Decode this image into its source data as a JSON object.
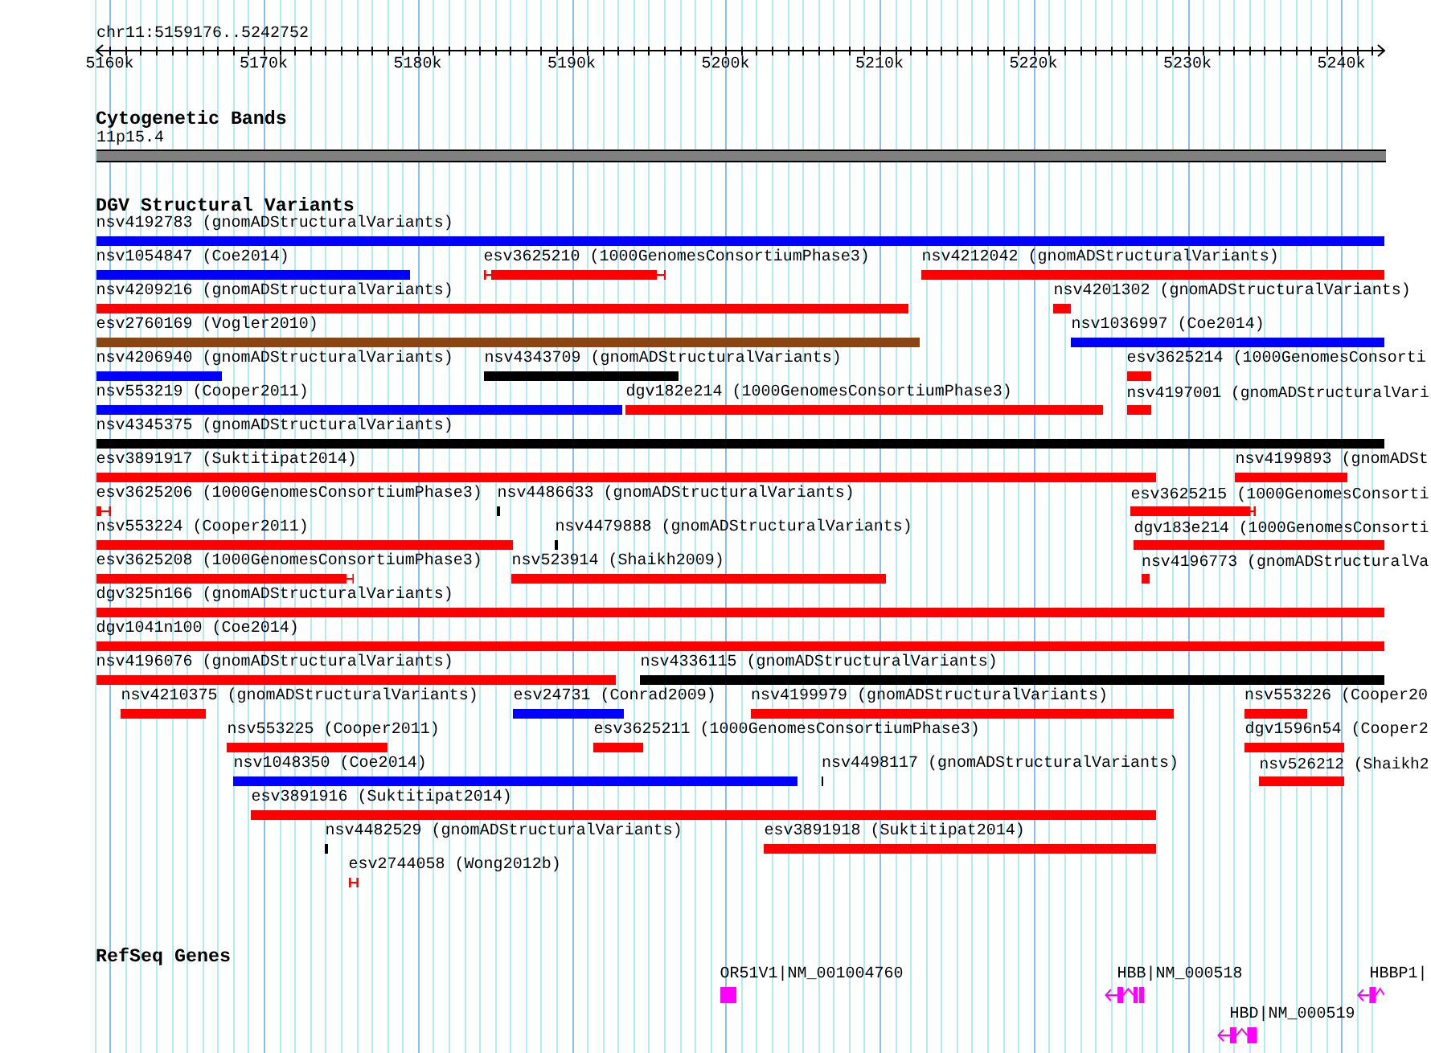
{
  "ruler": {
    "location": "chr11:5159176..5242752",
    "ticks": [
      "5160k",
      "5170k",
      "5180k",
      "5190k",
      "5200k",
      "5210k",
      "5220k",
      "5230k",
      "5240k"
    ]
  },
  "tracks": [
    {
      "kind": "bands",
      "title": "Cytogenetic Bands",
      "features": [
        {
          "label": "11p15.4"
        }
      ]
    },
    {
      "kind": "variants",
      "title": "DGV Structural Variants",
      "features": [
        {
          "label": "nsv4192783 (gnomADStructuralVariants)",
          "color": "#0000ff"
        },
        {
          "label": "nsv1054847 (Coe2014)",
          "color": "#0000ff"
        },
        {
          "label": "esv3625210 (1000GenomesConsortiumPhase3)",
          "color": "#ff0000"
        },
        {
          "label": "nsv4212042 (gnomADStructuralVariants)",
          "color": "#ff0000"
        },
        {
          "label": "nsv4209216 (gnomADStructuralVariants)",
          "color": "#ff0000"
        },
        {
          "label": "nsv4201302 (gnomADStructuralVariants)",
          "color": "#ff0000"
        },
        {
          "label": "esv2760169 (Vogler2010)",
          "color": "#8b4513"
        },
        {
          "label": "nsv1036997 (Coe2014)",
          "color": "#0000ff"
        },
        {
          "label": "nsv4206940 (gnomADStructuralVariants)",
          "color": "#0000ff"
        },
        {
          "label": "nsv4343709 (gnomADStructuralVariants)",
          "color": "#000000"
        },
        {
          "label": "esv3625214 (1000GenomesConsorti",
          "color": "#ff0000"
        },
        {
          "label": "nsv553219 (Cooper2011)",
          "color": "#0000ff"
        },
        {
          "label": "dgv182e214 (1000GenomesConsortiumPhase3)",
          "color": "#ff0000"
        },
        {
          "label": "nsv4197001 (gnomADStructuralVari",
          "color": "#ff0000"
        },
        {
          "label": "nsv4345375 (gnomADStructuralVariants)",
          "color": "#000000"
        },
        {
          "label": "esv3891917 (Suktitipat2014)",
          "color": "#ff0000"
        },
        {
          "label": "nsv4199893 (gnomADSt",
          "color": "#ff0000"
        },
        {
          "label": "esv3625206 (1000GenomesConsortiumPhase3)",
          "color": "#ff0000"
        },
        {
          "label": "nsv4486633 (gnomADStructuralVariants)",
          "color": "#000000"
        },
        {
          "label": "esv3625215 (1000GenomesConsorti",
          "color": "#ff0000"
        },
        {
          "label": "nsv553224 (Cooper2011)",
          "color": "#ff0000"
        },
        {
          "label": "nsv4479888 (gnomADStructuralVariants)",
          "color": "#000000"
        },
        {
          "label": "dgv183e214 (1000GenomesConsorti",
          "color": "#ff0000"
        },
        {
          "label": "esv3625208 (1000GenomesConsortiumPhase3)",
          "color": "#ff0000"
        },
        {
          "label": "nsv523914 (Shaikh2009)",
          "color": "#ff0000"
        },
        {
          "label": "nsv4196773 (gnomADStructuralVa",
          "color": "#ff0000"
        },
        {
          "label": "dgv325n166 (gnomADStructuralVariants)",
          "color": "#ff0000"
        },
        {
          "label": "dgv1041n100 (Coe2014)",
          "color": "#ff0000"
        },
        {
          "label": "nsv4196076 (gnomADStructuralVariants)",
          "color": "#ff0000"
        },
        {
          "label": "nsv4336115 (gnomADStructuralVariants)",
          "color": "#000000"
        },
        {
          "label": "nsv4210375 (gnomADStructuralVariants)",
          "color": "#ff0000"
        },
        {
          "label": "esv24731 (Conrad2009)",
          "color": "#0000ff"
        },
        {
          "label": "nsv4199979 (gnomADStructuralVariants)",
          "color": "#ff0000"
        },
        {
          "label": "nsv553226 (Cooper20",
          "color": "#ff0000"
        },
        {
          "label": "nsv553225 (Cooper2011)",
          "color": "#ff0000"
        },
        {
          "label": "esv3625211 (1000GenomesConsortiumPhase3)",
          "color": "#ff0000"
        },
        {
          "label": "dgv1596n54 (Cooper2",
          "color": "#ff0000"
        },
        {
          "label": "nsv1048350 (Coe2014)",
          "color": "#0000ff"
        },
        {
          "label": "nsv4498117 (gnomADStructuralVariants)",
          "color": "#000000"
        },
        {
          "label": "nsv526212 (Shaikh2",
          "color": "#ff0000"
        },
        {
          "label": "esv3891916 (Suktitipat2014)",
          "color": "#ff0000"
        },
        {
          "label": "nsv4482529 (gnomADStructuralVariants)",
          "color": "#000000"
        },
        {
          "label": "esv3891918 (Suktitipat2014)",
          "color": "#ff0000"
        },
        {
          "label": "esv2744058 (Wong2012b)",
          "color": "#ff0000"
        }
      ]
    },
    {
      "kind": "genes",
      "title": "RefSeq Genes",
      "features": [
        {
          "label": "OR51V1|NM_001004760",
          "reverse_strand": false
        },
        {
          "label": "HBB|NM_000518",
          "reverse_strand": true
        },
        {
          "label": "HBD|NM_000519",
          "reverse_strand": true
        },
        {
          "label": "HBBP1|",
          "reverse_strand": true
        }
      ]
    }
  ]
}
